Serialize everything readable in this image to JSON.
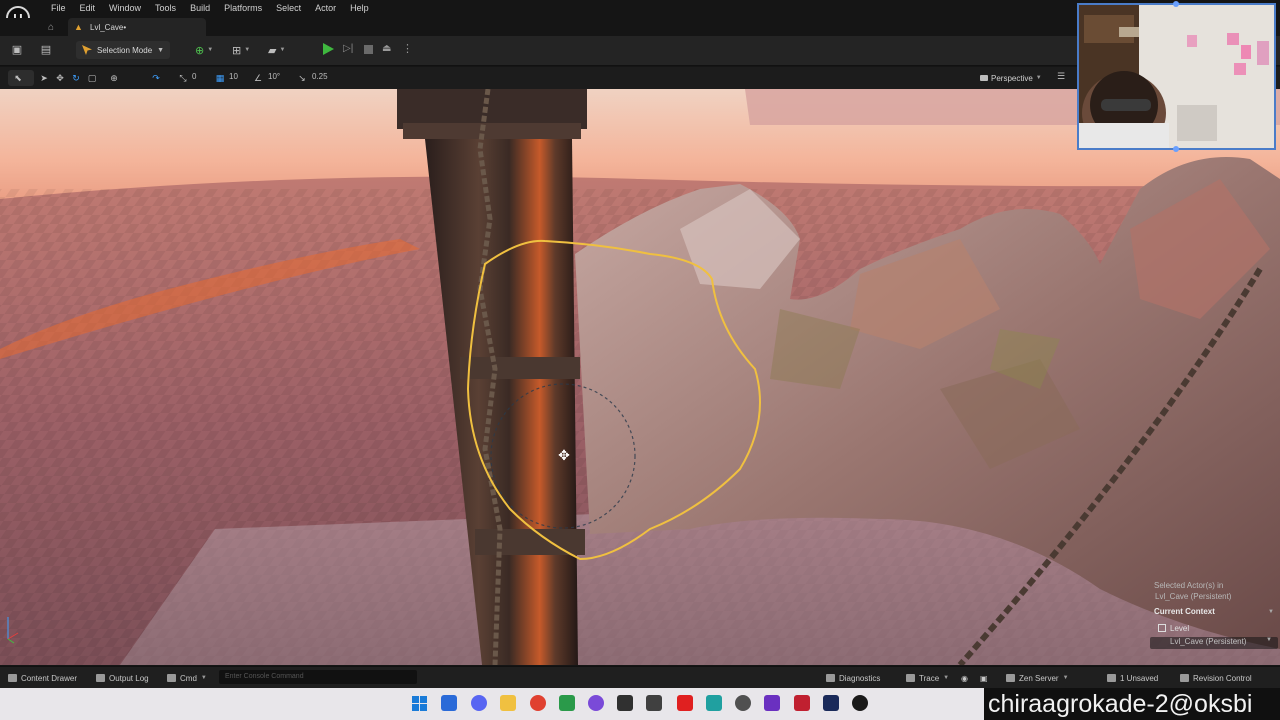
{
  "menu": {
    "items": [
      "File",
      "Edit",
      "Window",
      "Tools",
      "Build",
      "Platforms",
      "Select",
      "Actor",
      "Help"
    ]
  },
  "tab": {
    "level_name": "Lvl_Cave•"
  },
  "toolbar": {
    "mode_label": "Selection Mode"
  },
  "viewport_toolbar": {
    "grid_snap": "10",
    "rotation_snap": "10°",
    "scale_snap": "0.25",
    "translate_snap": "0",
    "view_mode": "Perspective"
  },
  "context_panel": {
    "selected_label": "Selected Actor(s) in",
    "selected_value": "Lvl_Cave (Persistent)",
    "current_context": "Current Context",
    "level_label": "Level",
    "persistent_label": "Lvl_Cave (Persistent)"
  },
  "statusbar": {
    "content_drawer": "Content Drawer",
    "output_log": "Output Log",
    "cmd": "Cmd",
    "console_placeholder": "Enter Console Command",
    "diagnostics": "Diagnostics",
    "trace": "Trace",
    "zen_server": "Zen Server",
    "unsaved": "1 Unsaved",
    "revision_control": "Revision Control"
  },
  "watermark": {
    "text": "chiraagrokade-2@oksbi"
  },
  "colors": {
    "accent_blue": "#3ea0ff",
    "play_green": "#3fb83f",
    "selection_outline": "#f0c040",
    "level_tab_icon": "#e0a030"
  }
}
